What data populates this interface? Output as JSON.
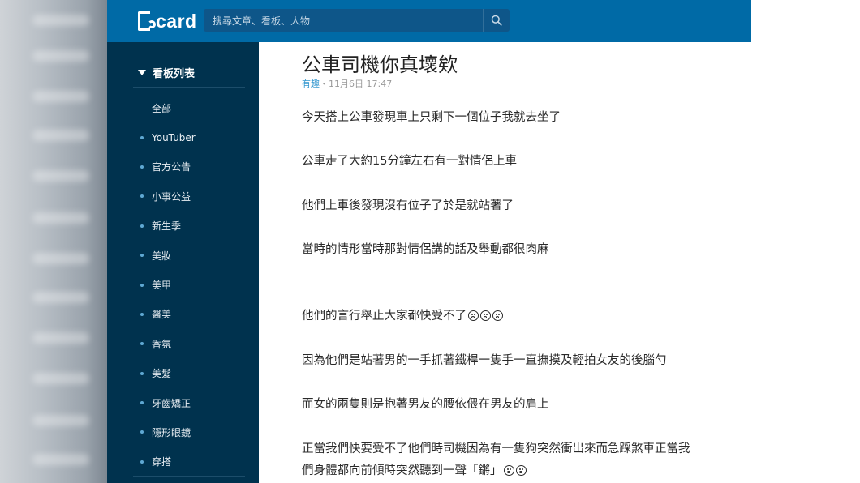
{
  "header": {
    "logo_text": "card",
    "search_placeholder": "搜尋文章、看板、人物"
  },
  "sidebar": {
    "heading": "看板列表",
    "items": [
      {
        "label": "全部",
        "dot": false
      },
      {
        "label": "YouTuber",
        "dot": true
      },
      {
        "label": "官方公告",
        "dot": true
      },
      {
        "label": "小事公益",
        "dot": true
      },
      {
        "label": "新生季",
        "dot": true
      },
      {
        "label": "美妝",
        "dot": true
      },
      {
        "label": "美甲",
        "dot": true
      },
      {
        "label": "醫美",
        "dot": true
      },
      {
        "label": "香氛",
        "dot": true
      },
      {
        "label": "美髮",
        "dot": true
      },
      {
        "label": "牙齒矯正",
        "dot": true
      },
      {
        "label": "隱形眼鏡",
        "dot": true
      },
      {
        "label": "穿搭",
        "dot": true
      }
    ]
  },
  "post": {
    "title": "公車司機你真壞欸",
    "board": "有趣",
    "separator": "・",
    "datetime": "11月6日 17:47",
    "paragraphs": [
      "今天搭上公車發現車上只剩下一個位子我就去坐了",
      "公車走了大約15分鐘左右有一對情侶上車",
      "他們上車後發現沒有位子了於是就站著了",
      "當時的情形當時那對情侶講的話及舉動都很肉麻",
      "他們的言行舉止大家都快受不了",
      "因為他們是站著男的一手抓著鐵桿一隻手一直撫摸及輕拍女友的後腦勺",
      "而女的兩隻則是抱著男友的腰依偎在男友的肩上",
      "正當我們快要受不了他們時司機因為有一隻狗突然衝出來而急踩煞車正當我",
      "們身體都向前傾時突然聽到一聲「鏘」"
    ],
    "emoji_counts": {
      "paragraph_5": 3,
      "paragraph_9": 2
    }
  },
  "colors": {
    "topbar": "#006aa6",
    "sidebar": "#00324e",
    "board_link": "#3397cf",
    "dot": "#5fa8d3"
  }
}
